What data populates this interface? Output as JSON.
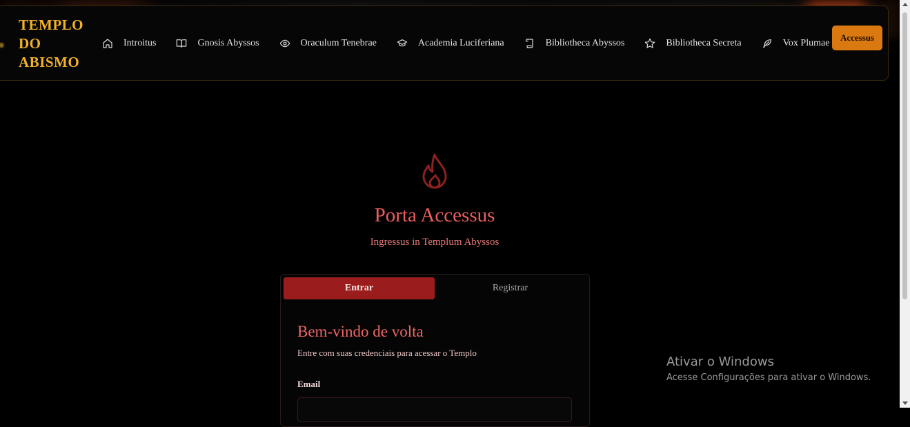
{
  "brand": {
    "line1": "TEMPLO",
    "line2": "DO",
    "line3": "ABISMO",
    "color": "#f2b225"
  },
  "nav": {
    "items": [
      {
        "label": "Introitus",
        "icon": "home-icon"
      },
      {
        "label": "Gnosis Abyssos",
        "icon": "book-open-icon"
      },
      {
        "label": "Oraculum Tenebrae",
        "icon": "eye-icon"
      },
      {
        "label": "Academia Luciferiana",
        "icon": "graduation-cap-icon"
      },
      {
        "label": "Bibliotheca Abyssos",
        "icon": "scroll-icon"
      },
      {
        "label": "Bibliotheca Secreta",
        "icon": "star-icon"
      },
      {
        "label": "Vox Plumae",
        "icon": "feather-icon"
      }
    ],
    "cta_label": "Accessus",
    "cta_color": "#d9790f"
  },
  "hero": {
    "icon": "flame-icon",
    "title": "Porta Accessus",
    "subtitle": "Ingressus in Templum Abyssos"
  },
  "auth": {
    "tabs": [
      {
        "label": "Entrar",
        "active": true
      },
      {
        "label": "Registrar",
        "active": false
      }
    ],
    "title": "Bem-vindo de volta",
    "description": "Entre com suas credenciais para acessar o Templo",
    "email_label": "Email",
    "email_value": ""
  },
  "watermark": {
    "title": "Ativar o Windows",
    "subtitle": "Acesse Configurações para ativar o Windows."
  },
  "colors": {
    "accent_red": "#9b1c1c",
    "title_red": "#ef5f5f",
    "background": "#000000"
  }
}
